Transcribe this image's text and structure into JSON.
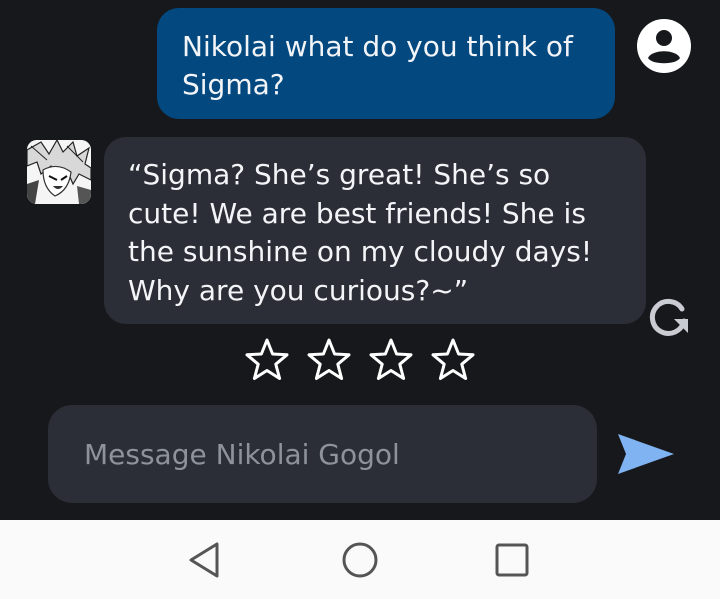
{
  "user_message": {
    "text": "Nikolai what do you think of Sigma?"
  },
  "bot_message": {
    "text": "“Sigma? She’s great! She’s so cute! We are best friends! She is the sunshine on my cloudy days! Why are you curious?~”"
  },
  "rating": {
    "stars": 0,
    "max": 4
  },
  "composer": {
    "placeholder": "Message Nikolai Gogol",
    "value": ""
  },
  "colors": {
    "background": "#17181c",
    "user_bubble": "#03497f",
    "bot_bubble": "#2b2e36",
    "send_accent": "#7fb3f2"
  },
  "icons": {
    "user": "account-circle-icon",
    "regenerate": "regenerate-icon",
    "send": "send-icon",
    "nav_back": "back-triangle-icon",
    "nav_home": "home-circle-icon",
    "nav_recents": "recents-square-icon"
  }
}
